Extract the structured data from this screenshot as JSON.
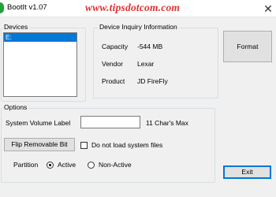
{
  "window": {
    "title": "BootIt v1.07",
    "watermark": "www.tipsdotcom.com",
    "close_glyph": "✕"
  },
  "devices": {
    "legend": "Devices",
    "items": [
      "E:"
    ],
    "selected": "E:"
  },
  "device_info": {
    "legend": "Device Inquiry Information",
    "rows": [
      {
        "label": "Capacity",
        "value": "-544 MB"
      },
      {
        "label": "Vendor",
        "value": "Lexar"
      },
      {
        "label": "Product",
        "value": "JD FireFly"
      }
    ]
  },
  "buttons": {
    "format": "Format",
    "flip": "Flip Removable Bit",
    "exit": "Exit"
  },
  "options": {
    "legend": "Options",
    "volume_label": "System Volume Label",
    "volume_value": "",
    "volume_hint": "11 Char's Max",
    "no_system_files": {
      "label": "Do not load system files",
      "checked": false
    },
    "partition": {
      "label": "Partition",
      "options": [
        "Active",
        "Non-Active"
      ],
      "selected": "Active"
    }
  },
  "colors": {
    "selection": "#0078d7",
    "watermark": "#e03030",
    "app_icon": "#22a33a"
  }
}
